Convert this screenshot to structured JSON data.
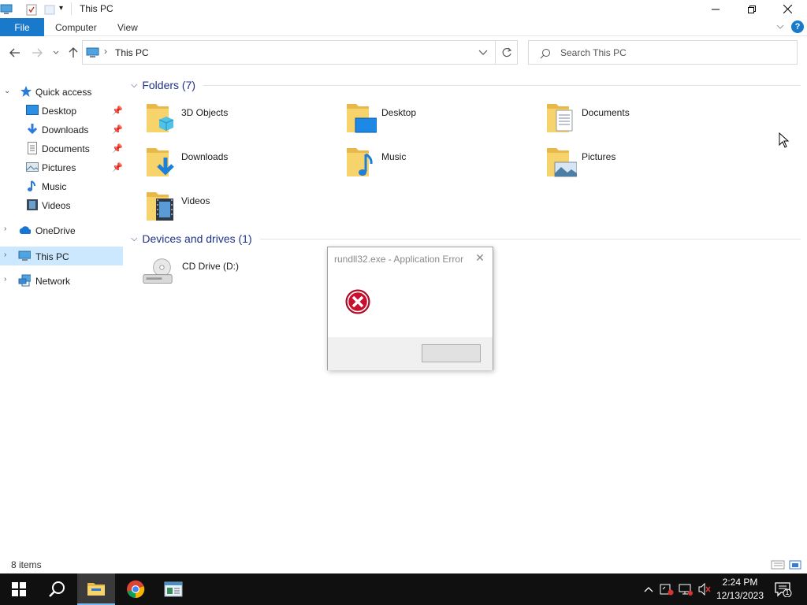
{
  "window": {
    "title": "This PC",
    "tabs": {
      "file": "File",
      "computer": "Computer",
      "view": "View"
    },
    "help": "?"
  },
  "address": {
    "path": "This PC",
    "separator": "›"
  },
  "search": {
    "placeholder": "Search This PC"
  },
  "navpane": {
    "quick_access": "Quick access",
    "quick_items": [
      {
        "label": "Desktop",
        "icon": "desktop-icon",
        "pinned": true
      },
      {
        "label": "Downloads",
        "icon": "downloads-icon",
        "pinned": true
      },
      {
        "label": "Documents",
        "icon": "documents-icon",
        "pinned": true
      },
      {
        "label": "Pictures",
        "icon": "pictures-icon",
        "pinned": true
      },
      {
        "label": "Music",
        "icon": "music-icon",
        "pinned": false
      },
      {
        "label": "Videos",
        "icon": "videos-icon",
        "pinned": false
      }
    ],
    "onedrive": "OneDrive",
    "this_pc": "This PC",
    "network": "Network"
  },
  "folders": {
    "header": "Folders (7)",
    "items": [
      "3D Objects",
      "Desktop",
      "Documents",
      "Downloads",
      "Music",
      "Pictures",
      "Videos"
    ]
  },
  "drives": {
    "header": "Devices and drives (1)",
    "items": [
      "CD Drive (D:)"
    ]
  },
  "status": {
    "items": "8 items"
  },
  "dialog": {
    "title": "rundll32.exe - Application Error",
    "close": "✕",
    "ok_label": ""
  },
  "taskbar": {
    "time": "2:24 PM",
    "date": "12/13/2023",
    "notifications": "1"
  },
  "colors": {
    "accent": "#1979ca",
    "selected": "#cce8ff",
    "header": "#1e3287",
    "taskbar": "#101010"
  }
}
